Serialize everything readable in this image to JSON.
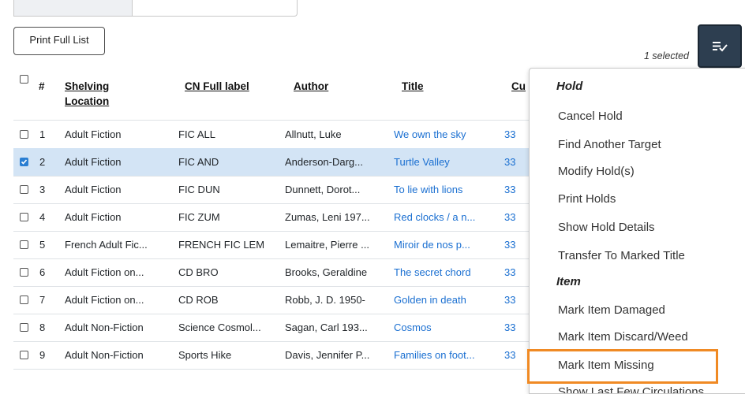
{
  "toolbar": {
    "print_label": "Print Full List",
    "selected_label": "1 selected",
    "actions_icon": "list-check-icon"
  },
  "columns": {
    "num": "#",
    "shelving_line1": "Shelving",
    "shelving_line2": "Location",
    "cn": "CN Full label",
    "author": "Author",
    "title": "Title",
    "cur": "Cu"
  },
  "rows": [
    {
      "n": "1",
      "shelving": "Adult Fiction",
      "cn": "FIC ALL",
      "author": "Allnutt, Luke",
      "title": "We own the sky",
      "cur": "33",
      "checked": false
    },
    {
      "n": "2",
      "shelving": "Adult Fiction",
      "cn": "FIC AND",
      "author": "Anderson-Darg...",
      "title": "Turtle Valley",
      "cur": "33",
      "checked": true
    },
    {
      "n": "3",
      "shelving": "Adult Fiction",
      "cn": "FIC DUN",
      "author": "Dunnett, Dorot...",
      "title": "To lie with lions",
      "cur": "33",
      "checked": false
    },
    {
      "n": "4",
      "shelving": "Adult Fiction",
      "cn": "FIC ZUM",
      "author": "Zumas, Leni 197...",
      "title": "Red clocks / a n...",
      "cur": "33",
      "checked": false
    },
    {
      "n": "5",
      "shelving": "French Adult Fic...",
      "cn": "FRENCH FIC LEM",
      "author": "Lemaitre, Pierre ...",
      "title": "Miroir de nos p...",
      "cur": "33",
      "checked": false
    },
    {
      "n": "6",
      "shelving": "Adult Fiction on...",
      "cn": "CD BRO",
      "author": "Brooks, Geraldine",
      "title": "The secret chord",
      "cur": "33",
      "checked": false
    },
    {
      "n": "7",
      "shelving": "Adult Fiction on...",
      "cn": "CD ROB",
      "author": "Robb, J. D. 1950-",
      "title": "Golden in death",
      "cur": "33",
      "checked": false
    },
    {
      "n": "8",
      "shelving": "Adult Non-Fiction",
      "cn": "Science Cosmol...",
      "author": "Sagan, Carl 193...",
      "title": "Cosmos",
      "cur": "33",
      "checked": false
    },
    {
      "n": "9",
      "shelving": "Adult Non-Fiction",
      "cn": "Sports Hike",
      "author": "Davis, Jennifer P...",
      "title": "Families on foot...",
      "cur": "33",
      "checked": false
    }
  ],
  "menu": {
    "hold_header": "Hold",
    "hold_items": [
      "Cancel Hold",
      "Find Another Target",
      "Modify Hold(s)",
      "Print Holds",
      "Show Hold Details",
      "Transfer To Marked Title"
    ],
    "item_header": "Item",
    "item_items": [
      "Mark Item Damaged",
      "Mark Item Discard/Weed",
      "Mark Item Missing",
      "Show Last Few Circulations"
    ],
    "highlighted": "Mark Item Missing"
  },
  "colors": {
    "selected_row": "#d3e4f5",
    "link": "#1a6fd1",
    "actions_button": "#2d3e50",
    "highlight_box": "#f08a24"
  }
}
